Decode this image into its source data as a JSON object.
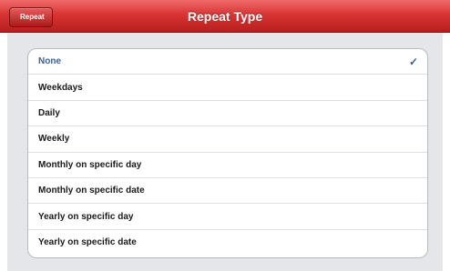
{
  "navbar": {
    "back_label": "Repeat",
    "title": "Repeat Type"
  },
  "options": [
    {
      "label": "None",
      "selected": true
    },
    {
      "label": "Weekdays",
      "selected": false
    },
    {
      "label": "Daily",
      "selected": false
    },
    {
      "label": "Weekly",
      "selected": false
    },
    {
      "label": "Monthly on specific day",
      "selected": false
    },
    {
      "label": "Monthly on specific date",
      "selected": false
    },
    {
      "label": "Yearly on specific day",
      "selected": false
    },
    {
      "label": "Yearly on specific date",
      "selected": false
    }
  ],
  "check_glyph": "✓",
  "colors": {
    "navbar": "#d93434",
    "selected_text": "#3b5f96",
    "background": "#e4e6ea"
  }
}
